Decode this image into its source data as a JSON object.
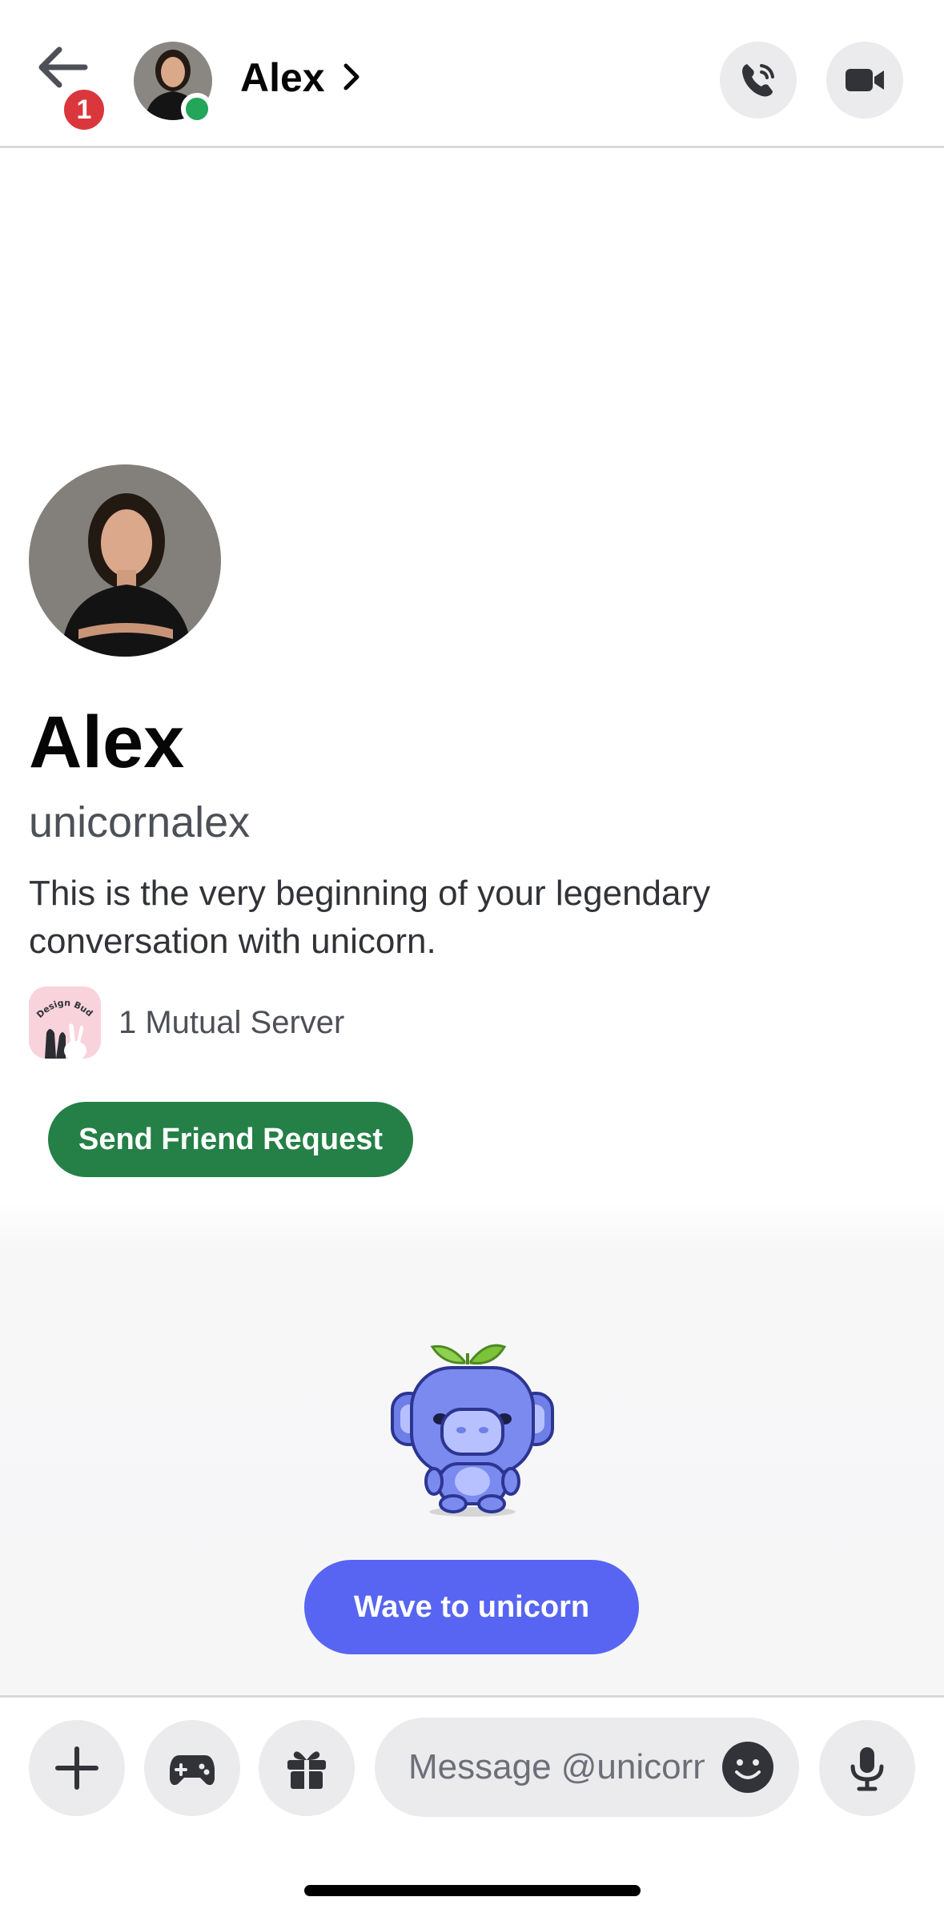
{
  "header": {
    "title": "Alex",
    "back_badge_count": "1",
    "status": "online",
    "icons": [
      "back-arrow-icon",
      "chevron-right-icon",
      "phone-icon",
      "video-camera-icon"
    ]
  },
  "profile": {
    "display_name": "Alex",
    "username": "unicornalex",
    "description": "This is the very beginning of your legendary conversation with unicorn.",
    "mutual_servers_label": "1 Mutual Server",
    "mutual_server_icon_text": "Design Buddies",
    "send_friend_request_label": "Send Friend Request"
  },
  "wave": {
    "sticker": "wumpus-sticker",
    "button_label": "Wave to unicorn"
  },
  "composer": {
    "placeholder": "Message @unicorn",
    "icons": [
      "plus-icon",
      "gamepad-icon",
      "gift-icon",
      "emoji-icon",
      "microphone-icon"
    ]
  },
  "colors": {
    "friend_button": "#248046",
    "wave_button": "#5865f2",
    "badge": "#da373c",
    "status_online": "#23a55a"
  }
}
